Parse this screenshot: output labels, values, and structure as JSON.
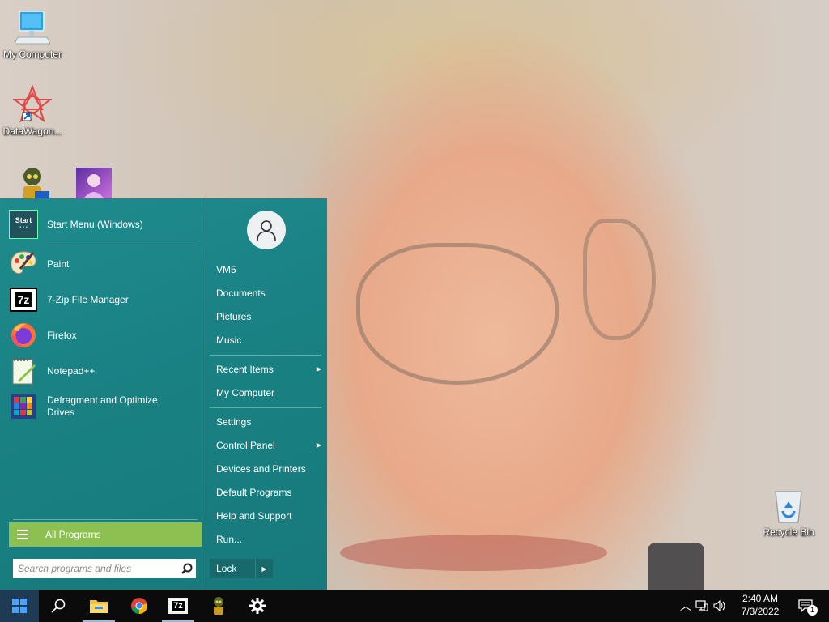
{
  "desktop": {
    "icons": [
      {
        "label": "My Computer",
        "icon": "monitor-icon"
      },
      {
        "label": "DataWagon...",
        "icon": "datawagon-icon"
      },
      {
        "label": "",
        "icon": "robot-shortcut-icon"
      },
      {
        "label": "",
        "icon": "anime-shortcut-icon"
      },
      {
        "label": "Recycle Bin",
        "icon": "recycle-bin-icon"
      }
    ]
  },
  "start_menu": {
    "pinned": {
      "label": "Start Menu (Windows)",
      "icon": "start-menu-icon",
      "icon_text": "Start"
    },
    "programs": [
      {
        "label": "Paint",
        "icon": "paint-palette-icon"
      },
      {
        "label": "7-Zip File Manager",
        "icon": "7zip-icon",
        "icon_text": "7z"
      },
      {
        "label": "Firefox",
        "icon": "firefox-icon"
      },
      {
        "label": "Notepad++",
        "icon": "notepad-plus-plus-icon"
      },
      {
        "label": "Defragment and Optimize Drives",
        "icon": "defrag-icon"
      }
    ],
    "all_programs": "All Programs",
    "search_placeholder": "Search programs and files",
    "right_items": {
      "user": "VM5",
      "documents": "Documents",
      "pictures": "Pictures",
      "music": "Music",
      "recent": "Recent Items",
      "computer": "My Computer",
      "settings": "Settings",
      "control_panel": "Control Panel",
      "devices": "Devices and Printers",
      "default_programs": "Default Programs",
      "help": "Help and Support",
      "run": "Run..."
    },
    "lock": "Lock"
  },
  "taskbar": {
    "buttons": [
      "windows-start-icon",
      "search-icon",
      "file-explorer-icon",
      "chrome-icon",
      "7zip-icon",
      "robot-app-icon",
      "settings-gear-icon"
    ],
    "seven_zip_text": "7z",
    "time": "2:40 AM",
    "date": "7/3/2022",
    "notification_count": "1"
  },
  "colors": {
    "start_menu_bg": "#1a8284",
    "all_programs_bg": "#8cc152",
    "taskbar_bg": "#0b0b0b"
  }
}
